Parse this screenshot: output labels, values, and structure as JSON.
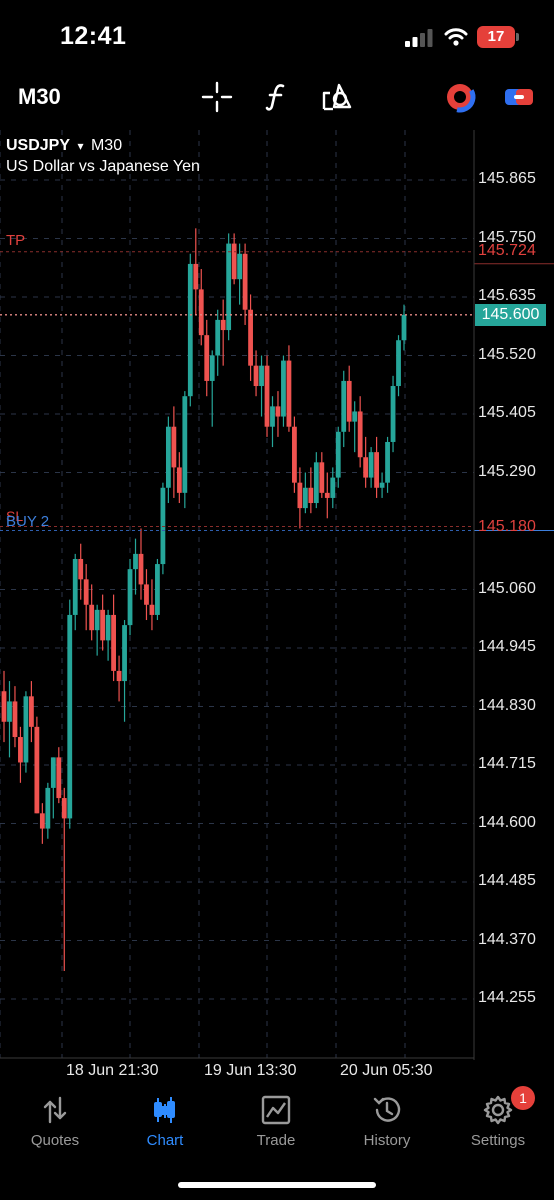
{
  "status_bar": {
    "time": "12:41",
    "battery": "17"
  },
  "toolbar": {
    "timeframe": "M30",
    "icons": [
      "crosshair-icon",
      "function-icon",
      "objects-icon",
      "one-click-trading-icon",
      "account-switch-icon"
    ]
  },
  "chart": {
    "symbol": "USDJPY",
    "dropdown_arrow": "▾",
    "timeframe": "M30",
    "description": "US Dollar vs Japanese Yen",
    "price_ticks": [
      "145.865",
      "145.750",
      "145.635",
      "145.520",
      "145.405",
      "145.290",
      "145.060",
      "144.945",
      "144.830",
      "144.715",
      "144.600",
      "144.485",
      "144.370",
      "144.255"
    ],
    "lines": {
      "tp": {
        "label": "TP",
        "price": "145.724",
        "color": "#e0413e"
      },
      "current": {
        "price": "145.600",
        "color": "#26a69a"
      },
      "buy": {
        "label": "BUY 2",
        "sl_label": "SL",
        "price": "145.180",
        "color": "#3d7fdc"
      }
    },
    "date_labels": [
      "18 Jun 21:30",
      "19 Jun 13:30",
      "20 Jun 05:30"
    ],
    "up_color": "#26a69a",
    "down_color": "#ef5350"
  },
  "chart_data": {
    "type": "candlestick",
    "symbol": "USDJPY",
    "timeframe": "M30",
    "candles": [
      [
        144.86,
        144.9,
        144.76,
        144.8
      ],
      [
        144.8,
        144.88,
        144.73,
        144.84
      ],
      [
        144.84,
        144.87,
        144.75,
        144.77
      ],
      [
        144.77,
        144.79,
        144.68,
        144.72
      ],
      [
        144.72,
        144.86,
        144.7,
        144.85
      ],
      [
        144.85,
        144.88,
        144.76,
        144.79
      ],
      [
        144.79,
        144.81,
        144.62,
        144.62
      ],
      [
        144.62,
        144.64,
        144.56,
        144.59
      ],
      [
        144.59,
        144.68,
        144.57,
        144.67
      ],
      [
        144.67,
        144.73,
        144.61,
        144.73
      ],
      [
        144.73,
        144.75,
        144.64,
        144.65
      ],
      [
        144.65,
        144.67,
        144.31,
        144.61
      ],
      [
        144.61,
        145.04,
        144.59,
        145.01
      ],
      [
        145.01,
        145.13,
        144.98,
        145.12
      ],
      [
        145.12,
        145.15,
        145.04,
        145.08
      ],
      [
        145.08,
        145.11,
        144.98,
        145.03
      ],
      [
        145.03,
        145.07,
        144.96,
        144.98
      ],
      [
        144.98,
        145.03,
        144.93,
        145.02
      ],
      [
        145.02,
        145.05,
        144.94,
        144.96
      ],
      [
        144.96,
        145.02,
        144.92,
        145.01
      ],
      [
        145.01,
        145.05,
        144.88,
        144.9
      ],
      [
        144.9,
        144.93,
        144.84,
        144.88
      ],
      [
        144.88,
        145.0,
        144.8,
        144.99
      ],
      [
        144.99,
        145.12,
        144.97,
        145.1
      ],
      [
        145.1,
        145.16,
        145.05,
        145.13
      ],
      [
        145.13,
        145.18,
        145.04,
        145.07
      ],
      [
        145.07,
        145.1,
        145.0,
        145.03
      ],
      [
        145.03,
        145.08,
        144.98,
        145.01
      ],
      [
        145.01,
        145.12,
        145.0,
        145.11
      ],
      [
        145.11,
        145.27,
        145.09,
        145.26
      ],
      [
        145.26,
        145.4,
        145.23,
        145.38
      ],
      [
        145.38,
        145.42,
        145.24,
        145.3
      ],
      [
        145.3,
        145.33,
        145.23,
        145.25
      ],
      [
        145.25,
        145.45,
        145.22,
        145.44
      ],
      [
        145.44,
        145.72,
        145.42,
        145.7
      ],
      [
        145.7,
        145.77,
        145.6,
        145.65
      ],
      [
        145.65,
        145.69,
        145.54,
        145.56
      ],
      [
        145.56,
        145.59,
        145.44,
        145.47
      ],
      [
        145.47,
        145.53,
        145.38,
        145.52
      ],
      [
        145.52,
        145.61,
        145.48,
        145.59
      ],
      [
        145.59,
        145.63,
        145.5,
        145.57
      ],
      [
        145.57,
        145.76,
        145.55,
        145.74
      ],
      [
        145.74,
        145.76,
        145.66,
        145.67
      ],
      [
        145.67,
        145.74,
        145.62,
        145.72
      ],
      [
        145.72,
        145.74,
        145.58,
        145.61
      ],
      [
        145.61,
        145.64,
        145.47,
        145.5
      ],
      [
        145.5,
        145.53,
        145.44,
        145.46
      ],
      [
        145.46,
        145.52,
        145.4,
        145.5
      ],
      [
        145.5,
        145.52,
        145.36,
        145.38
      ],
      [
        145.38,
        145.44,
        145.34,
        145.42
      ],
      [
        145.42,
        145.45,
        145.36,
        145.4
      ],
      [
        145.4,
        145.52,
        145.38,
        145.51
      ],
      [
        145.51,
        145.54,
        145.37,
        145.38
      ],
      [
        145.38,
        145.4,
        145.25,
        145.27
      ],
      [
        145.27,
        145.3,
        145.18,
        145.22
      ],
      [
        145.22,
        145.29,
        145.21,
        145.26
      ],
      [
        145.26,
        145.3,
        145.21,
        145.23
      ],
      [
        145.23,
        145.33,
        145.22,
        145.31
      ],
      [
        145.31,
        145.33,
        145.24,
        145.25
      ],
      [
        145.25,
        145.29,
        145.2,
        145.24
      ],
      [
        145.24,
        145.3,
        145.22,
        145.28
      ],
      [
        145.28,
        145.38,
        145.26,
        145.37
      ],
      [
        145.37,
        145.49,
        145.34,
        145.47
      ],
      [
        145.47,
        145.5,
        145.37,
        145.39
      ],
      [
        145.39,
        145.43,
        145.33,
        145.41
      ],
      [
        145.41,
        145.44,
        145.3,
        145.32
      ],
      [
        145.32,
        145.36,
        145.26,
        145.28
      ],
      [
        145.28,
        145.34,
        145.26,
        145.33
      ],
      [
        145.33,
        145.36,
        145.24,
        145.26
      ],
      [
        145.26,
        145.29,
        145.24,
        145.27
      ],
      [
        145.27,
        145.36,
        145.25,
        145.35
      ],
      [
        145.35,
        145.48,
        145.33,
        145.46
      ],
      [
        145.46,
        145.56,
        145.44,
        145.55
      ],
      [
        145.55,
        145.62,
        145.53,
        145.6
      ]
    ],
    "ylim": [
      144.2,
      145.95
    ],
    "x_tick_labels": [
      "18 Jun 21:30",
      "19 Jun 13:30",
      "20 Jun 05:30"
    ],
    "tp": 145.724,
    "current_price": 145.6,
    "buy_price": 145.18
  },
  "nav": {
    "items": [
      {
        "label": "Quotes",
        "icon": "quotes-icon",
        "active": false
      },
      {
        "label": "Chart",
        "icon": "chart-icon",
        "active": true
      },
      {
        "label": "Trade",
        "icon": "trade-icon",
        "active": false
      },
      {
        "label": "History",
        "icon": "history-icon",
        "active": false
      },
      {
        "label": "Settings",
        "icon": "settings-icon",
        "active": false
      }
    ],
    "settings_badge": "1"
  }
}
